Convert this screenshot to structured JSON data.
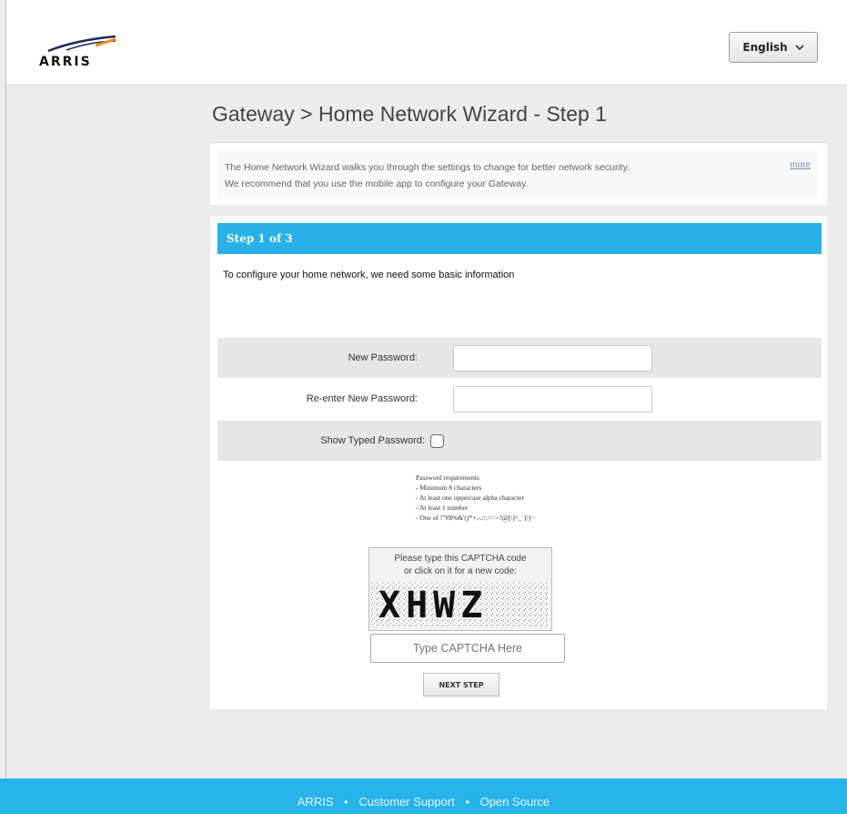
{
  "header": {
    "brand": "ARRIS",
    "language": "English"
  },
  "page": {
    "title": "Gateway > Home Network Wizard - Step 1"
  },
  "info": {
    "line1": "The Home Network Wizard walks you through the settings to change for better network security.",
    "line2": "We recommend that you use the mobile app to configure your Gateway.",
    "more": "more"
  },
  "wizard": {
    "step_label": "Step 1 of 3",
    "intro": "To configure your home network, we need some basic information",
    "new_password_label": "New Password:",
    "new_password_value": "",
    "reenter_password_label": "Re-enter New Password:",
    "reenter_password_value": "",
    "show_password_label": "Show Typed Password:",
    "show_password_checked": false,
    "requirements": {
      "title": "Password requirements",
      "items": [
        "- Minimum 8 characters",
        "- At least one uppercase alpha character",
        "- At least 1 number",
        "- One of !\"#$%&'()*+,-./:;<=>?@[\\]^_`{|}~"
      ]
    },
    "captcha": {
      "prompt_line1": "Please type this CAPTCHA code",
      "prompt_line2": "or click on it for a new code:",
      "code": "XHWZ",
      "placeholder": "Type CAPTCHA Here"
    },
    "next_button": "NEXT STEP"
  },
  "footer": {
    "links": [
      "ARRIS",
      "Customer Support",
      "Open Source"
    ],
    "separator": "•"
  },
  "colors": {
    "accent": "#28b1e8",
    "background": "#ececec"
  }
}
